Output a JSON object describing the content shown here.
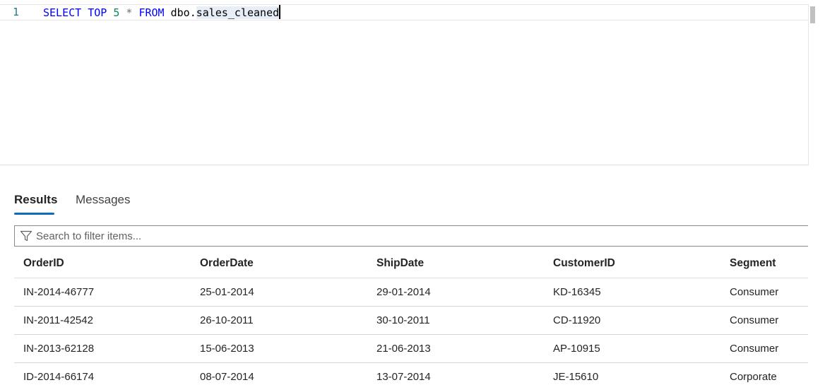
{
  "editor": {
    "line_number": "1",
    "tokens": {
      "select": "SELECT",
      "top": "TOP",
      "num": "5",
      "star": "*",
      "from": "FROM",
      "schema": "dbo.",
      "table": "sales_cleaned"
    }
  },
  "tabs": {
    "results": "Results",
    "messages": "Messages"
  },
  "filter": {
    "placeholder": "Search to filter items..."
  },
  "grid": {
    "columns": [
      "OrderID",
      "OrderDate",
      "ShipDate",
      "CustomerID",
      "Segment"
    ],
    "rows": [
      [
        "IN-2014-46777",
        "25-01-2014",
        "29-01-2014",
        "KD-16345",
        "Consumer"
      ],
      [
        "IN-2011-42542",
        "26-10-2011",
        "30-10-2011",
        "CD-11920",
        "Consumer"
      ],
      [
        "IN-2013-62128",
        "15-06-2013",
        "21-06-2013",
        "AP-10915",
        "Consumer"
      ],
      [
        "ID-2014-66174",
        "08-07-2014",
        "13-07-2014",
        "JE-15610",
        "Corporate"
      ]
    ]
  },
  "colors": {
    "keyword": "#0000ff",
    "number": "#098658",
    "accent": "#0f6cbd"
  }
}
